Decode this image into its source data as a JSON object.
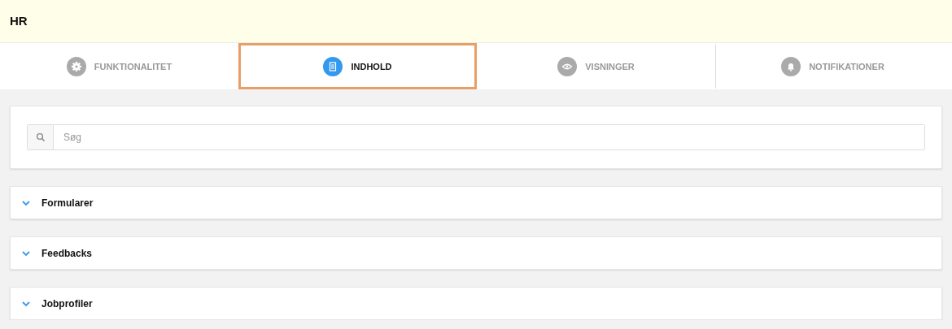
{
  "header": {
    "title": "HR"
  },
  "tabs": [
    {
      "label": "FUNKTIONALITET",
      "kind": "gear",
      "selected": false
    },
    {
      "label": "INDHOLD",
      "kind": "document",
      "selected": true
    },
    {
      "label": "VISNINGER",
      "kind": "eye",
      "selected": false
    },
    {
      "label": "NOTIFIKATIONER",
      "kind": "bell",
      "selected": false
    }
  ],
  "search": {
    "placeholder": "Søg"
  },
  "sections": [
    {
      "title": "Formularer",
      "expanded": false
    },
    {
      "title": "Feedbacks",
      "expanded": false
    },
    {
      "title": "Jobprofiler",
      "expanded": false
    }
  ]
}
